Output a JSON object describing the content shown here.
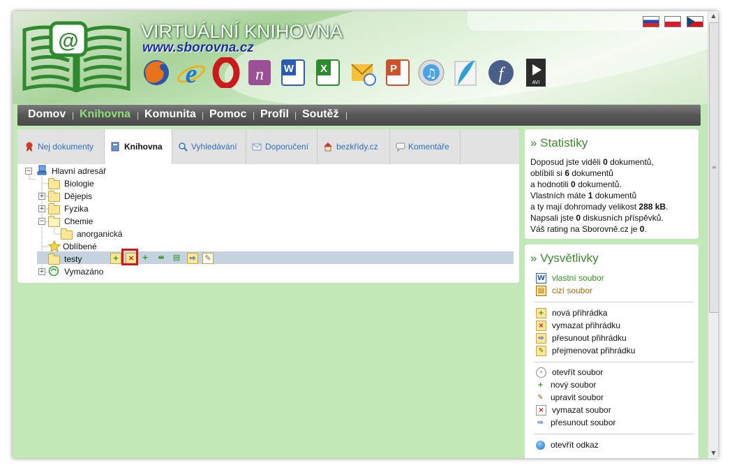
{
  "site": {
    "title": "VIRTUÁLNÍ KNIHOVNA",
    "url": "www.sborovna.cz"
  },
  "languages": [
    "slovak-flag",
    "polish-flag",
    "czech-flag"
  ],
  "app_icons": [
    "firefox-icon",
    "internet-explorer-icon",
    "opera-icon",
    "onenote-icon",
    "word-icon",
    "excel-icon",
    "outlook-icon",
    "powerpoint-icon",
    "itunes-icon",
    "feather-icon",
    "flash-icon",
    "avi-video-icon"
  ],
  "nav": [
    {
      "label": "Domov",
      "active": false
    },
    {
      "label": "Knihovna",
      "active": true
    },
    {
      "label": "Komunita",
      "active": false
    },
    {
      "label": "Pomoc",
      "active": false
    },
    {
      "label": "Profil",
      "active": false
    },
    {
      "label": "Soutěž",
      "active": false
    }
  ],
  "nav_separator": "|",
  "tabs": [
    {
      "label": "Nej dokumenty",
      "icon": "ribbon-icon"
    },
    {
      "label": "Knihovna",
      "icon": "book-icon",
      "active": true
    },
    {
      "label": "Vyhledávání",
      "icon": "magnifier-icon"
    },
    {
      "label": "Doporučení",
      "icon": "envelope-icon"
    },
    {
      "label": "bezkřídy.cz",
      "icon": "house-icon"
    },
    {
      "label": "Komentáře",
      "icon": "comment-icon"
    }
  ],
  "tree": {
    "root": "Hlavní adresář",
    "items": [
      {
        "label": "Biologie"
      },
      {
        "label": "Dějepis",
        "expander": "+"
      },
      {
        "label": "Fyzika",
        "expander": "+"
      },
      {
        "label": "Chemie",
        "expander": "−"
      },
      {
        "label": "anorganická"
      },
      {
        "label": "Oblíbené"
      },
      {
        "label": "testy"
      },
      {
        "label": "Vymazáno",
        "expander": "+"
      }
    ],
    "root_expander": "−",
    "selected": "testy"
  },
  "folder_actions": [
    "new-folder-icon",
    "delete-folder-icon",
    "new-file-icon",
    "move-icon",
    "edit-file-icon",
    "move-folder-icon",
    "rename-icon"
  ],
  "stats": {
    "title": "» Statistiky",
    "lines": [
      [
        "Doposud jste viděli ",
        "0",
        " dokumentů,"
      ],
      [
        "oblíbili si ",
        "6",
        " dokumentů"
      ],
      [
        "a hodnotili ",
        "0",
        " dokumentů."
      ],
      [
        "Vlastních máte ",
        "1",
        " dokumentů"
      ],
      [
        "a ty mají dohromady velikost ",
        "288 kB",
        "."
      ],
      [
        "Napsali jste ",
        "0",
        " diskusních příspěvků."
      ],
      [
        "Váš rating na Sborovně.cz je ",
        "0",
        "."
      ]
    ]
  },
  "legend": {
    "title": "» Vysvětlivky",
    "groups": [
      [
        {
          "label": "vlastní soubor",
          "icon": "word-doc-icon"
        },
        {
          "label": "cizí soubor",
          "icon": "foreign-doc-icon"
        }
      ],
      [
        {
          "label": "nová přihrádka",
          "icon": "new-folder-icon"
        },
        {
          "label": "vymazat přihrádku",
          "icon": "delete-folder-icon"
        },
        {
          "label": "přesunout přihrádku",
          "icon": "move-folder-icon"
        },
        {
          "label": "přejmenovat přihrádku",
          "icon": "rename-folder-icon"
        }
      ],
      [
        {
          "label": "otevřít soubor",
          "icon": "open-file-icon"
        },
        {
          "label": "nový soubor",
          "icon": "new-file-icon"
        },
        {
          "label": "upravit soubor",
          "icon": "edit-file-icon"
        },
        {
          "label": "vymazat soubor",
          "icon": "delete-file-icon"
        },
        {
          "label": "přesunout soubor",
          "icon": "move-file-icon"
        }
      ],
      [
        {
          "label": "otevřít odkaz",
          "icon": "globe-icon"
        }
      ]
    ]
  },
  "colors": {
    "background": "#c3e8b8",
    "accent": "#3c8a2c",
    "navbar": "#5a5a5a",
    "active_nav": "#8fe07a",
    "link": "#2c6fbf"
  }
}
